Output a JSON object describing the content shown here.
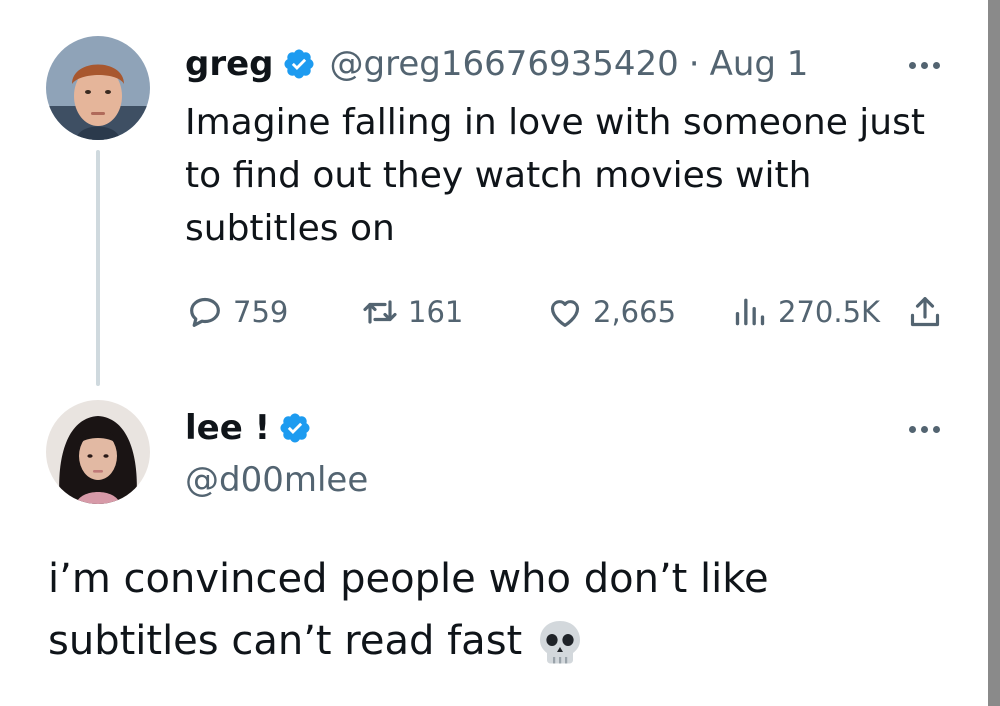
{
  "tweet": {
    "author": {
      "name": "greg",
      "handle": "@greg16676935420",
      "verified": true,
      "avatar_icon": "avatar-photo"
    },
    "separator": "·",
    "date": "Aug 1",
    "text": "Imagine falling in love with someone just to find out they watch movies with subtitles on",
    "stats": {
      "replies": "759",
      "retweets": "161",
      "likes": "2,665",
      "views": "270.5K"
    },
    "icons": [
      "reply-icon",
      "retweet-icon",
      "like-icon",
      "views-icon",
      "share-icon",
      "more-icon"
    ]
  },
  "reply": {
    "author": {
      "name": "lee !",
      "handle": "@d00mlee",
      "verified": true,
      "avatar_icon": "avatar-photo"
    },
    "text": "i’m convinced people who don’t like subtitles can’t read fast",
    "emoji": "skull-emoji"
  },
  "colors": {
    "text": "#0f1419",
    "muted": "#536471",
    "verified": "#1d9bf0",
    "thread_line": "#cfd9de"
  }
}
